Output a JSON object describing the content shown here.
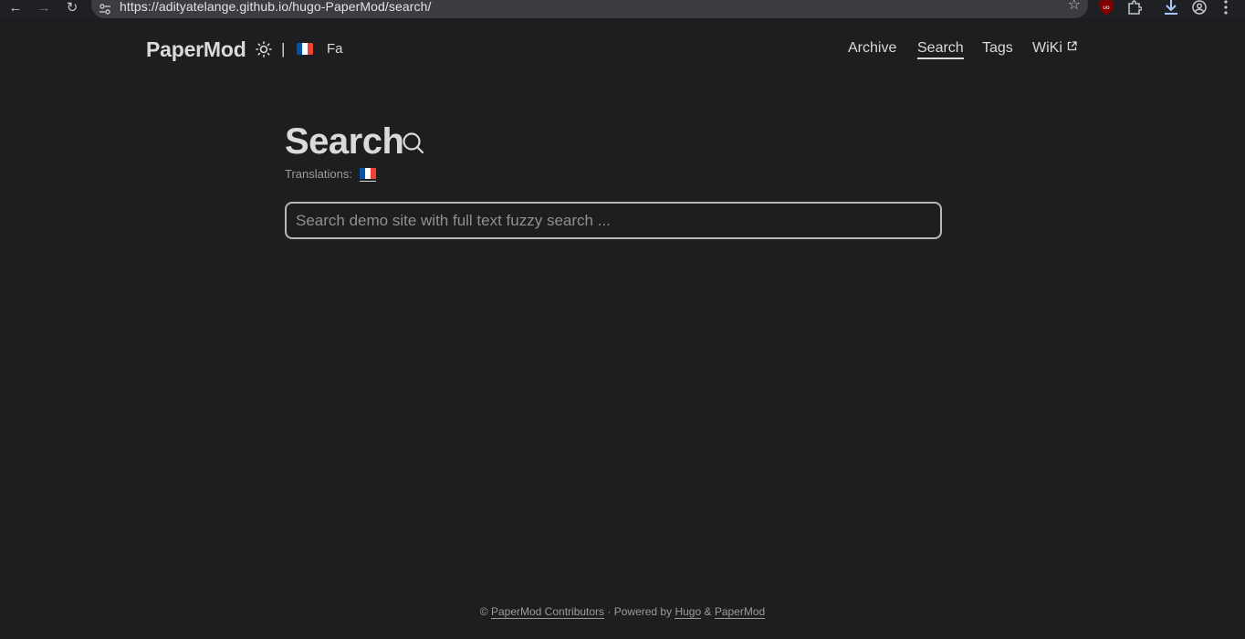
{
  "browser": {
    "back_icon": "←",
    "forward_icon": "→",
    "reload_icon": "↻",
    "url": "https://adityatelange.github.io/hugo-PaperMod/search/",
    "star_icon": "☆"
  },
  "header": {
    "logo": "PaperMod",
    "separator": "|",
    "lang_label": "Fa",
    "menu": {
      "archive": "Archive",
      "search": "Search",
      "tags": "Tags",
      "wiki": "WiKi"
    }
  },
  "main": {
    "title": "Search",
    "translations_label": "Translations:",
    "search_placeholder": "Search demo site with full text fuzzy search ..."
  },
  "footer": {
    "copyright": "©",
    "contributors": "PaperMod Contributors",
    "powered_by": "· Powered by",
    "hugo": "Hugo",
    "amp": "&",
    "papermod": "PaperMod"
  },
  "colors": {
    "background": "#1d1e20",
    "text": "#dadadb",
    "secondary": "#9b9c9d",
    "flag_blue": "#0055a4",
    "flag_white": "#ffffff",
    "flag_red": "#ef4135"
  }
}
